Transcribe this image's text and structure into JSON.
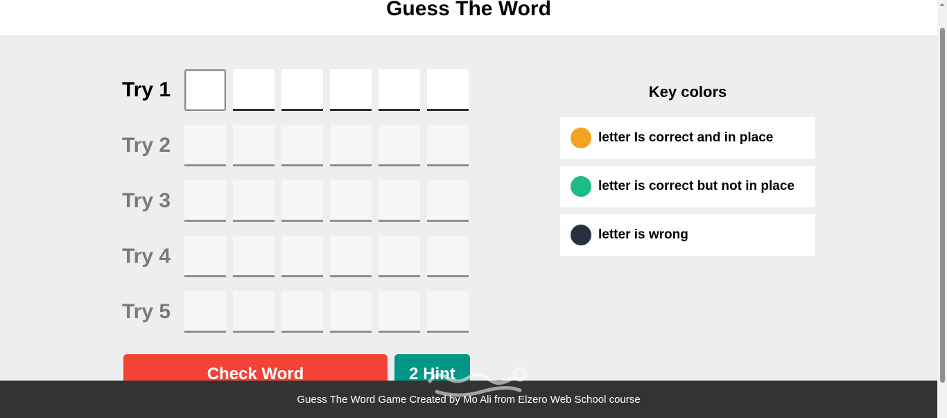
{
  "header": {
    "title": "Guess The Word"
  },
  "game": {
    "tries": [
      {
        "label": "Try 1",
        "active": true
      },
      {
        "label": "Try 2",
        "active": false
      },
      {
        "label": "Try 3",
        "active": false
      },
      {
        "label": "Try 4",
        "active": false
      },
      {
        "label": "Try 5",
        "active": false
      }
    ],
    "letters_per_try": 6,
    "check_label": "Check Word",
    "hint_label": "2 Hint"
  },
  "key_colors": {
    "title": "Key colors",
    "items": [
      {
        "color": "#f4a221",
        "text": "letter Is correct and in place"
      },
      {
        "color": "#1cbc87",
        "text": "letter is correct but not in place"
      },
      {
        "color": "#27303f",
        "text": "letter is wrong"
      }
    ]
  },
  "footer": {
    "text": "Guess The Word Game Created by Mo Ali from Elzero Web School course"
  }
}
